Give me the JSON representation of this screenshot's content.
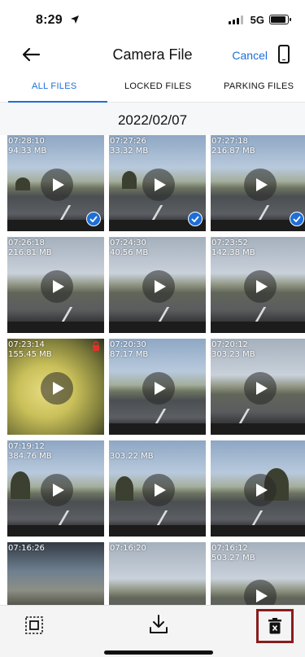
{
  "status_bar": {
    "time": "8:29",
    "network": "5G"
  },
  "nav": {
    "title": "Camera File",
    "cancel_label": "Cancel"
  },
  "tabs": [
    {
      "label": "ALL FILES",
      "active": true
    },
    {
      "label": "LOCKED FILES",
      "active": false
    },
    {
      "label": "PARKING FILES",
      "active": false
    }
  ],
  "date_header": "2022/02/07",
  "colors": {
    "accent": "#1e6ed8",
    "lock_red": "#e0322c",
    "highlight_border": "#8b1c1c"
  },
  "files": [
    {
      "time": "07:28:10",
      "size": "94.33 MB",
      "selected": true,
      "locked": false
    },
    {
      "time": "07:27:26",
      "size": "33.32 MB",
      "selected": true,
      "locked": false
    },
    {
      "time": "07:27:18",
      "size": "216.87 MB",
      "selected": true,
      "locked": false
    },
    {
      "time": "07:26:18",
      "size": "216.81 MB",
      "selected": false,
      "locked": false
    },
    {
      "time": "07:24:30",
      "size": "40.56 MB",
      "selected": false,
      "locked": false
    },
    {
      "time": "07:23:52",
      "size": "142.38 MB",
      "selected": false,
      "locked": false
    },
    {
      "time": "07:23:14",
      "size": "155.45 MB",
      "selected": false,
      "locked": true
    },
    {
      "time": "07:20:30",
      "size": "87.17 MB",
      "selected": false,
      "locked": false
    },
    {
      "time": "07:20:12",
      "size": "303.23 MB",
      "selected": false,
      "locked": false
    },
    {
      "time": "07:19:12",
      "size": "384.76 MB",
      "selected": false,
      "locked": false
    },
    {
      "time": "",
      "size": "303.22 MB",
      "selected": false,
      "locked": false
    },
    {
      "time": "",
      "size": "",
      "selected": false,
      "locked": false
    },
    {
      "time": "07:16:26",
      "size": "",
      "selected": false,
      "locked": false
    },
    {
      "time": "07:16:20",
      "size": "",
      "selected": false,
      "locked": false
    },
    {
      "time": "07:16:12",
      "size": "503.27 MB",
      "selected": false,
      "locked": false
    }
  ],
  "toolbar": {
    "icons": [
      "select-all-icon",
      "download-icon",
      "delete-icon"
    ]
  }
}
